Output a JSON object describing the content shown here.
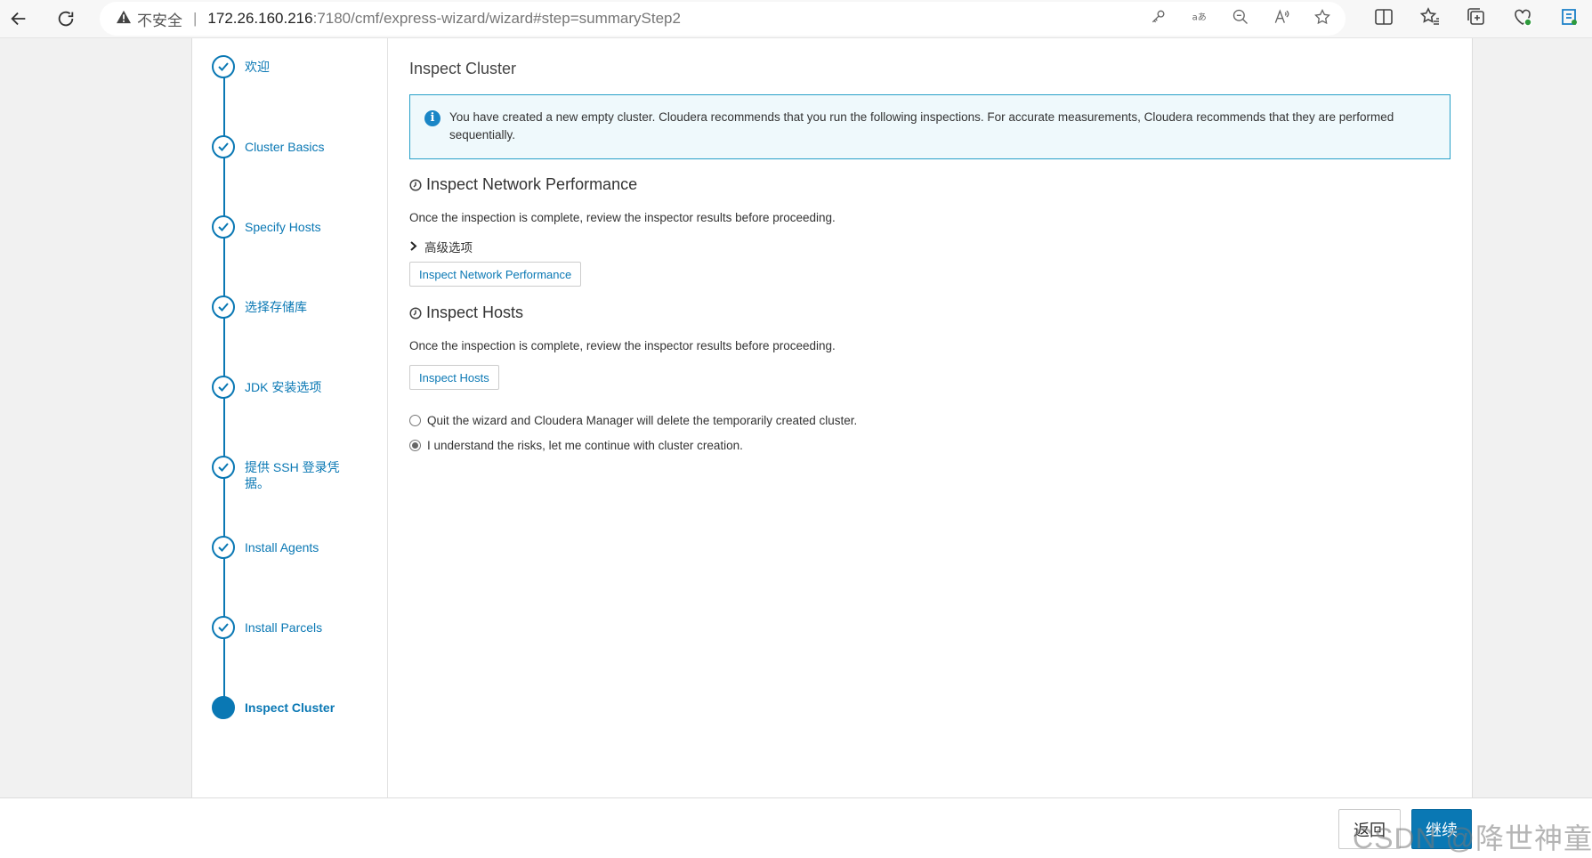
{
  "browser": {
    "insecure_label": "不安全",
    "url_host": "172.26.160.216",
    "url_path": ":7180/cmf/express-wizard/wizard#step=summaryStep2"
  },
  "sidebar": {
    "steps": [
      {
        "label": "欢迎",
        "status": "done"
      },
      {
        "label": "Cluster Basics",
        "status": "done"
      },
      {
        "label": "Specify Hosts",
        "status": "done"
      },
      {
        "label": "选择存储库",
        "status": "done"
      },
      {
        "label": "JDK 安装选项",
        "status": "done"
      },
      {
        "label": "提供 SSH 登录凭据。",
        "status": "done"
      },
      {
        "label": "Install Agents",
        "status": "done"
      },
      {
        "label": "Install Parcels",
        "status": "done"
      },
      {
        "label": "Inspect Cluster",
        "status": "active"
      }
    ]
  },
  "main": {
    "title": "Inspect Cluster",
    "info": "You have created a new empty cluster. Cloudera recommends that you run the following inspections. For accurate measurements, Cloudera recommends that they are performed sequentially.",
    "network": {
      "title": "Inspect Network Performance",
      "desc": "Once the inspection is complete, review the inspector results before proceeding.",
      "advanced": "高级选项",
      "button": "Inspect Network Performance"
    },
    "hosts": {
      "title": "Inspect Hosts",
      "desc": "Once the inspection is complete, review the inspector results before proceeding.",
      "button": "Inspect Hosts"
    },
    "options": [
      {
        "label": "Quit the wizard and Cloudera Manager will delete the temporarily created cluster.",
        "selected": false
      },
      {
        "label": "I understand the risks, let me continue with cluster creation.",
        "selected": true
      }
    ]
  },
  "footer": {
    "back": "返回",
    "continue": "继续",
    "watermark": "CSDN @降世神童"
  },
  "colors": {
    "accent": "#0a78b4",
    "info_border": "#27a0c8"
  }
}
